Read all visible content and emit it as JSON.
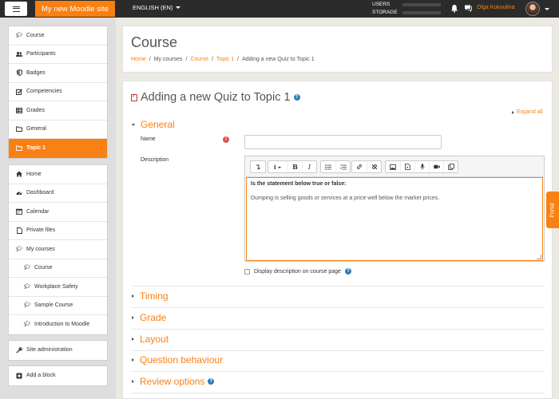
{
  "navbar": {
    "site_name": "My new Moodle site",
    "language": "ENGLISH (EN)",
    "usage": [
      {
        "label": "USERS",
        "fill": 0.0
      },
      {
        "label": "STORAGE",
        "fill": 0.0
      }
    ],
    "user_name": "Olga Kokoulina"
  },
  "drawer": {
    "course_nav": [
      {
        "icon": "graduation-cap-icon",
        "label": "Course"
      },
      {
        "icon": "users-icon",
        "label": "Participants"
      },
      {
        "icon": "badge-icon",
        "label": "Badges"
      },
      {
        "icon": "checkbox-icon",
        "label": "Competencies"
      },
      {
        "icon": "table-icon",
        "label": "Grades"
      },
      {
        "icon": "folder-icon",
        "label": "General"
      },
      {
        "icon": "folder-icon",
        "label": "Topic 1"
      }
    ],
    "site_nav": [
      {
        "icon": "home-icon",
        "label": "Home"
      },
      {
        "icon": "dashboard-icon",
        "label": "Dashboard"
      },
      {
        "icon": "calendar-icon",
        "label": "Calendar"
      },
      {
        "icon": "file-icon",
        "label": "Private files"
      },
      {
        "icon": "graduation-cap-icon",
        "label": "My courses"
      },
      {
        "icon": "graduation-cap-icon",
        "label": "Course"
      },
      {
        "icon": "graduation-cap-icon",
        "label": "Workplace Safety"
      },
      {
        "icon": "graduation-cap-icon",
        "label": "Sample Course"
      },
      {
        "icon": "graduation-cap-icon",
        "label": "Introduction to Moodle"
      }
    ],
    "admin": {
      "icon": "wrench-icon",
      "label": "Site administration"
    },
    "add_block": {
      "icon": "plus-square-icon",
      "label": "Add a block"
    }
  },
  "header": {
    "title": "Course",
    "breadcrumb": [
      "Home",
      "My courses",
      "Course",
      "Topic 1",
      "Adding a new Quiz to Topic 1"
    ],
    "separator": "/"
  },
  "form": {
    "heading": "Adding a new Quiz to Topic 1",
    "expand_all": "Expand all",
    "general_label": "General",
    "name_label": "Name",
    "name_value": "",
    "description_label": "Description",
    "editor_bold_text": "Is the statement below true or false:",
    "editor_text": "Dumping is selling goods or services at a price well below the market prices.",
    "display_description_label": "Display description on course page",
    "sections": [
      "Timing",
      "Grade",
      "Layout",
      "Question behaviour",
      "Review options"
    ]
  },
  "portal_tab": {
    "label": "Portal"
  },
  "colors": {
    "accent": "#f98012",
    "navbar": "#2b2b2b",
    "help": "#2f7db8"
  }
}
